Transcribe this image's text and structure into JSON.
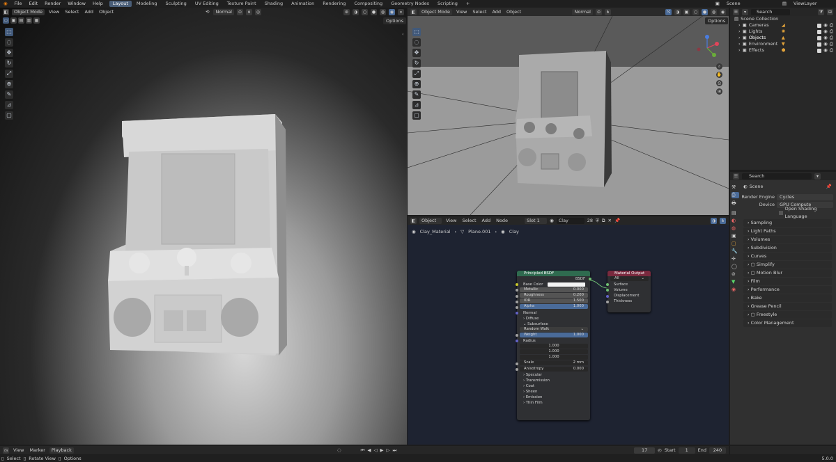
{
  "menu": [
    "File",
    "Edit",
    "Render",
    "Window",
    "Help"
  ],
  "workspaces": [
    "Layout",
    "Modeling",
    "Sculpting",
    "UV Editing",
    "Texture Paint",
    "Shading",
    "Animation",
    "Rendering",
    "Compositing",
    "Geometry Nodes",
    "Scripting"
  ],
  "workspace_add": "+",
  "scene": {
    "label": "Scene",
    "viewlayer": "ViewLayer"
  },
  "left_view": {
    "mode": "Object Mode",
    "menu": [
      "View",
      "Select",
      "Add",
      "Object"
    ],
    "orientation": "Normal",
    "options": "Options"
  },
  "right_view": {
    "mode": "Object Mode",
    "menu": [
      "View",
      "Select",
      "Add",
      "Object"
    ],
    "orientation": "Normal",
    "options": "Options"
  },
  "outliner": {
    "search": "Search",
    "root": "Scene Collection",
    "items": [
      "Cameras",
      "Lights",
      "Objects",
      "Environment",
      "Effects"
    ]
  },
  "properties": {
    "search": "Search",
    "scene": "Scene",
    "engine_label": "Render Engine",
    "engine": "Cycles",
    "device_label": "Device",
    "device": "GPU Compute",
    "osl": "Open Shading Language",
    "panels": [
      "Sampling",
      "Light Paths",
      "Volumes",
      "Subdivision",
      "Curves",
      "Simplify",
      "Motion Blur",
      "Film",
      "Performance",
      "Bake",
      "Grease Pencil",
      "Freestyle",
      "Color Management"
    ]
  },
  "node_editor": {
    "type": "Object",
    "menu": [
      "View",
      "Select",
      "Add",
      "Node"
    ],
    "slot": "Slot 1",
    "material": "Clay",
    "users": "28",
    "breadcrumb": [
      "Clay_Material",
      "Plane.001",
      "Clay"
    ]
  },
  "bsdf": {
    "title": "Principled BSDF",
    "out": "BSDF",
    "rows": [
      {
        "label": "Base Color",
        "value": ""
      },
      {
        "label": "Metallic",
        "value": "0.000"
      },
      {
        "label": "Roughness",
        "value": "0.200"
      },
      {
        "label": "IOR",
        "value": "1.500"
      },
      {
        "label": "Alpha",
        "value": "1.000"
      }
    ],
    "normal": "Normal",
    "diffuse": "Diffuse",
    "subsurface": "Subsurface",
    "method": "Random Walk",
    "weight_label": "Weight",
    "weight": "1.000",
    "radius": "Radius",
    "radius_vals": [
      "1.000",
      "1.000",
      "1.000"
    ],
    "scale_label": "Scale",
    "scale": "2 mm",
    "aniso_label": "Anisotropy",
    "aniso": "0.000",
    "sections": [
      "Specular",
      "Transmission",
      "Coat",
      "Sheen",
      "Emission",
      "Thin Film"
    ]
  },
  "matout": {
    "title": "Material Output",
    "target": "All",
    "inputs": [
      "Surface",
      "Volume",
      "Displacement",
      "Thickness"
    ]
  },
  "timeline": {
    "menu": [
      "View",
      "Marker",
      "Playback"
    ],
    "frame": "17",
    "start_label": "Start",
    "start": "1",
    "end_label": "End",
    "end": "240"
  },
  "status": {
    "items": [
      "Select",
      "Rotate View",
      "Options"
    ],
    "version": "5.0.0"
  },
  "colors": {
    "accent": "#4a5e78",
    "bsdf_header": "#2f6b4f",
    "output_header": "#7a2a3e"
  }
}
